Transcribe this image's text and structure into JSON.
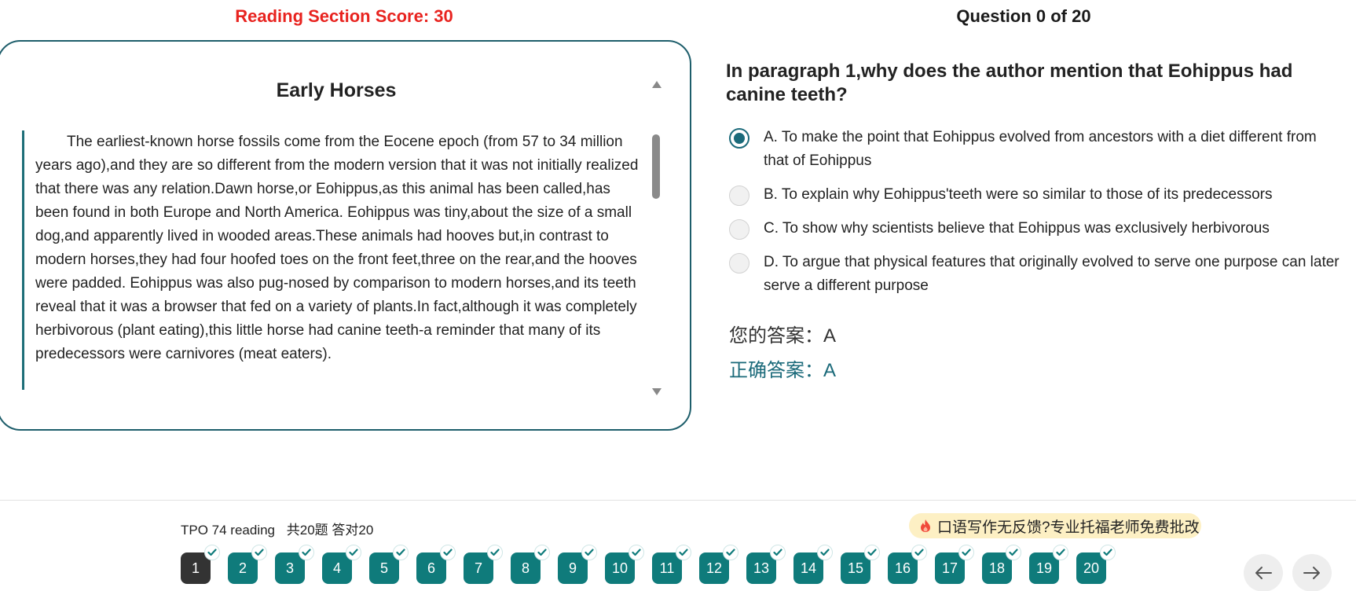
{
  "header": {
    "score": "Reading Section Score: 30",
    "question_count": "Question 0 of 20"
  },
  "passage": {
    "title": "Early Horses",
    "text": "The earliest-known horse fossils come from the Eocene epoch (from 57 to 34 million years ago),and they are so different from the modern version that it was not initially realized that there was any relation.Dawn horse,or Eohippus,as this animal has been called,has been found in both Europe and North America. Eohippus was tiny,about the size of a small dog,and apparently lived in wooded areas.These animals had hooves but,in contrast to modern horses,they had four hoofed toes on the front feet,three on the rear,and the hooves were padded. Eohippus was also pug-nosed by comparison to modern horses,and its teeth reveal that it was a browser that fed on a variety of plants.In fact,although it was completely herbivorous (plant eating),this little horse had canine teeth-a reminder that many of its predecessors were carnivores (meat eaters)."
  },
  "question": {
    "prompt": "In paragraph 1,why does the author mention that Eohippus had canine teeth?",
    "options": [
      {
        "label": "A. To make the point that Eohippus evolved from ancestors with a diet different from that of Eohippus",
        "selected": true
      },
      {
        "label": "B. To explain why Eohippus'teeth were so similar to those of its predecessors",
        "selected": false
      },
      {
        "label": "C. To show why scientists believe that Eohippus was exclusively herbivorous",
        "selected": false
      },
      {
        "label": "D. To argue that physical features that originally evolved to serve one purpose can later serve a different purpose",
        "selected": false
      }
    ],
    "your_answer": "您的答案：A",
    "correct_answer": "正确答案：A"
  },
  "footer": {
    "test_name": "TPO 74 reading",
    "summary": "共20题 答对20",
    "promo": "口语写作无反馈?专业托福老师免费批改",
    "question_buttons": [
      "1",
      "2",
      "3",
      "4",
      "5",
      "6",
      "7",
      "8",
      "9",
      "10",
      "11",
      "12",
      "13",
      "14",
      "15",
      "16",
      "17",
      "18",
      "19",
      "20"
    ],
    "current_question": 1,
    "prev_icon": "arrow-left-icon",
    "next_icon": "arrow-right-icon"
  },
  "colors": {
    "score": "#e8231f",
    "accent": "#1b6a7a",
    "question_button": "#0f7b7b",
    "current_button": "#333333",
    "promo_bg": "#fdf0c4"
  }
}
